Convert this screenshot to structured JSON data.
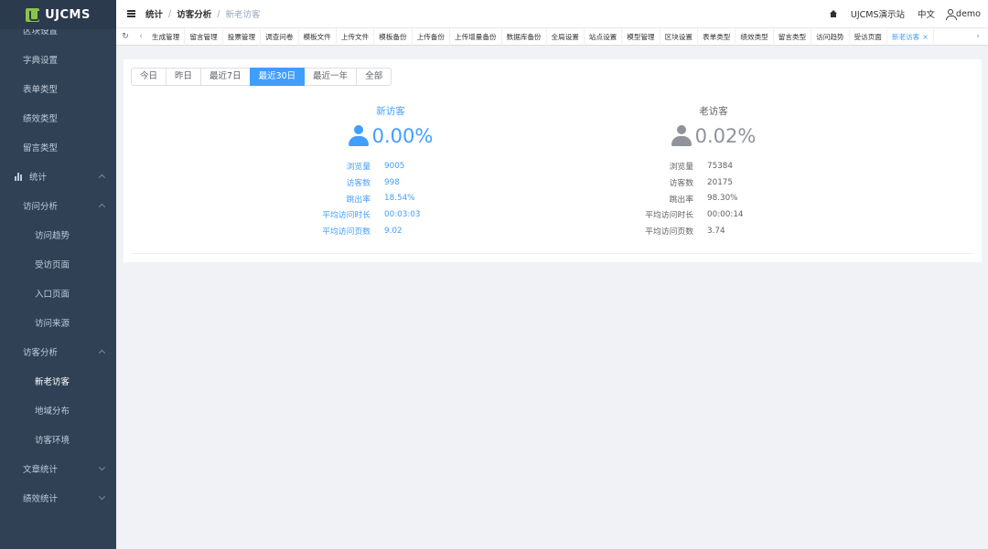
{
  "app": {
    "name": "UJCMS"
  },
  "sidebar": {
    "items": [
      {
        "label": "区块设置",
        "level": "l1"
      },
      {
        "label": "字典设置",
        "level": "l1"
      },
      {
        "label": "表单类型",
        "level": "l1"
      },
      {
        "label": "绩效类型",
        "level": "l1"
      },
      {
        "label": "留言类型",
        "level": "l1"
      },
      {
        "label": "统计",
        "level": "top",
        "arrow": "up",
        "icon": "bar-chart-icon"
      },
      {
        "label": "访问分析",
        "level": "l2",
        "arrow": "up"
      },
      {
        "label": "访问趋势",
        "level": "l3"
      },
      {
        "label": "受访页面",
        "level": "l3"
      },
      {
        "label": "入口页面",
        "level": "l3"
      },
      {
        "label": "访问来源",
        "level": "l3"
      },
      {
        "label": "访客分析",
        "level": "l2",
        "arrow": "up"
      },
      {
        "label": "新老访客",
        "level": "l3",
        "active": true
      },
      {
        "label": "地域分布",
        "level": "l3"
      },
      {
        "label": "访客环境",
        "level": "l3"
      },
      {
        "label": "文章统计",
        "level": "l2",
        "arrow": "down"
      },
      {
        "label": "绩效统计",
        "level": "l2",
        "arrow": "down"
      }
    ]
  },
  "header": {
    "breadcrumb": [
      "统计",
      "访客分析",
      "新老访客"
    ],
    "site": "UJCMS演示站",
    "lang": "中文",
    "user": "demo"
  },
  "tabs": {
    "items": [
      "生成管理",
      "留言管理",
      "投票管理",
      "调查问卷",
      "模板文件",
      "上传文件",
      "模板备份",
      "上传备份",
      "上传增量备份",
      "数据库备份",
      "全局设置",
      "站点设置",
      "模型管理",
      "区块设置",
      "表单类型",
      "绩效类型",
      "留言类型",
      "访问趋势",
      "受访页面",
      "新老访客"
    ],
    "active_index": 19,
    "close_glyph": "×",
    "refresh_glyph": "↻",
    "prev_glyph": "‹",
    "next_glyph": "›"
  },
  "filters": {
    "options": [
      "今日",
      "昨日",
      "最近7日",
      "最近30日",
      "最近一年",
      "全部"
    ],
    "active_index": 3
  },
  "new_visitor": {
    "title": "新访客",
    "percent": "0.00%",
    "stats": [
      {
        "label": "浏览量",
        "value": "9005"
      },
      {
        "label": "访客数",
        "value": "998"
      },
      {
        "label": "跳出率",
        "value": "18.54%"
      },
      {
        "label": "平均访问时长",
        "value": "00:03:03"
      },
      {
        "label": "平均访问页数",
        "value": "9.02"
      }
    ]
  },
  "old_visitor": {
    "title": "老访客",
    "percent": "0.02%",
    "stats": [
      {
        "label": "浏览量",
        "value": "75384"
      },
      {
        "label": "访客数",
        "value": "20175"
      },
      {
        "label": "跳出率",
        "value": "98.30%"
      },
      {
        "label": "平均访问时长",
        "value": "00:00:14"
      },
      {
        "label": "平均访问页数",
        "value": "3.74"
      }
    ]
  },
  "colors": {
    "sidebar": "#304156",
    "accent": "#409eff",
    "muted": "#909399"
  }
}
